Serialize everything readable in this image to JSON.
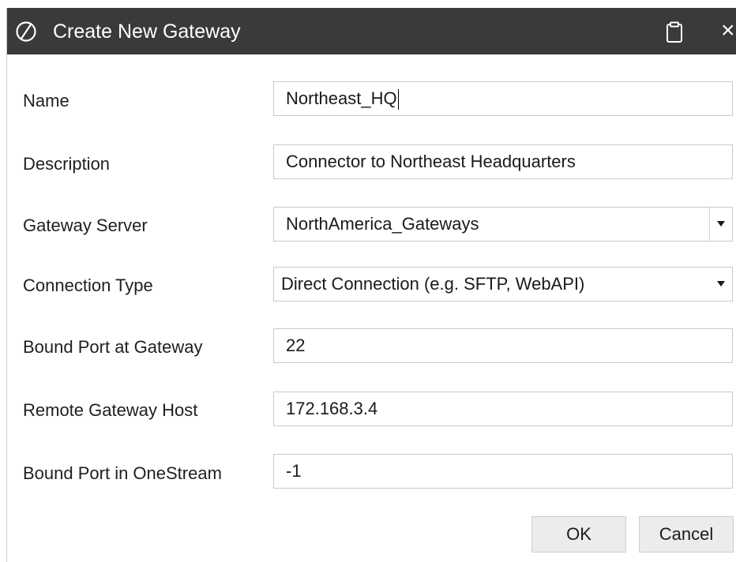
{
  "dialog": {
    "title": "Create New Gateway",
    "icons": {
      "logo": "onestream-logo-icon",
      "clipboard": "clipboard-icon",
      "close": "close-icon"
    },
    "close_glyph": "×"
  },
  "form": {
    "name": {
      "label": "Name",
      "value": "Northeast_HQ"
    },
    "description": {
      "label": "Description",
      "value": "Connector to Northeast Headquarters"
    },
    "gateway_server": {
      "label": "Gateway Server",
      "value": "NorthAmerica_Gateways"
    },
    "connection_type": {
      "label": "Connection Type",
      "value": "Direct Connection (e.g. SFTP, WebAPI)"
    },
    "bound_port_gateway": {
      "label": "Bound Port at Gateway",
      "value": "22"
    },
    "remote_gateway_host": {
      "label": "Remote Gateway Host",
      "value": "172.168.3.4"
    },
    "bound_port_onestream": {
      "label": "Bound Port in OneStream",
      "value": "-1"
    }
  },
  "buttons": {
    "ok": "OK",
    "cancel": "Cancel"
  },
  "colors": {
    "titlebar": "#3a3a3a",
    "button_bg": "#ececec",
    "field_border": "#c9c9c9"
  }
}
